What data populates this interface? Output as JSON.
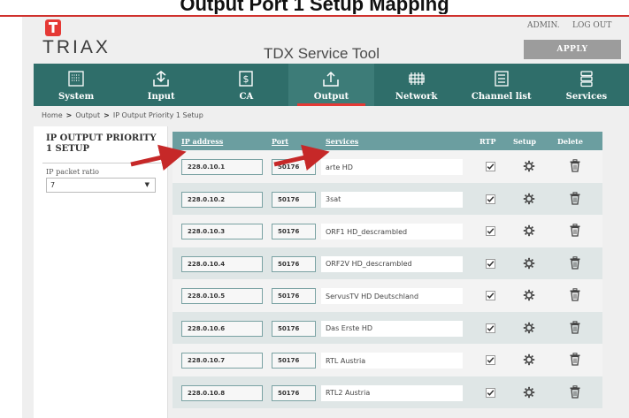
{
  "caption": "Output Port 1 Setup Mapping",
  "header": {
    "logo_text": "TRIAX",
    "app_title": "TDX Service Tool",
    "admin_label": "ADMIN.",
    "logout_label": "LOG OUT",
    "apply_label": "APPLY"
  },
  "nav": [
    {
      "label": "System",
      "icon": "system-icon"
    },
    {
      "label": "Input",
      "icon": "input-icon"
    },
    {
      "label": "CA",
      "icon": "ca-icon"
    },
    {
      "label": "Output",
      "icon": "output-icon",
      "active": true
    },
    {
      "label": "Network",
      "icon": "network-icon"
    },
    {
      "label": "Channel list",
      "icon": "channel-list-icon"
    },
    {
      "label": "Services",
      "icon": "services-icon"
    }
  ],
  "breadcrumb": {
    "home": "Home",
    "output": "Output",
    "page": "IP Output Priority 1 Setup"
  },
  "left_panel": {
    "title": "IP OUTPUT PRIORITY 1 SETUP",
    "ratio_label": "IP packet ratio",
    "ratio_value": "7"
  },
  "table": {
    "headers": {
      "ip": "IP address",
      "port": "Port",
      "services": "Services",
      "rtp": "RTP",
      "setup": "Setup",
      "delete": "Delete"
    },
    "rows": [
      {
        "ip": "228.0.10.1",
        "port": "50176",
        "service": "arte HD",
        "rtp": true
      },
      {
        "ip": "228.0.10.2",
        "port": "50176",
        "service": "3sat",
        "rtp": true
      },
      {
        "ip": "228.0.10.3",
        "port": "50176",
        "service": "ORF1 HD_descrambled",
        "rtp": true
      },
      {
        "ip": "228.0.10.4",
        "port": "50176",
        "service": "ORF2V HD_descrambled",
        "rtp": true
      },
      {
        "ip": "228.0.10.5",
        "port": "50176",
        "service": "ServusTV HD Deutschland",
        "rtp": true
      },
      {
        "ip": "228.0.10.6",
        "port": "50176",
        "service": "Das Erste HD",
        "rtp": true
      },
      {
        "ip": "228.0.10.7",
        "port": "50176",
        "service": "RTL Austria",
        "rtp": true
      },
      {
        "ip": "228.0.10.8",
        "port": "50176",
        "service": "RTL2 Austria",
        "rtp": true
      }
    ]
  },
  "colors": {
    "brand_red": "#e53935",
    "nav_teal": "#2f6e6a",
    "table_header": "#6b9ea0",
    "arrow_red": "#c62828"
  }
}
